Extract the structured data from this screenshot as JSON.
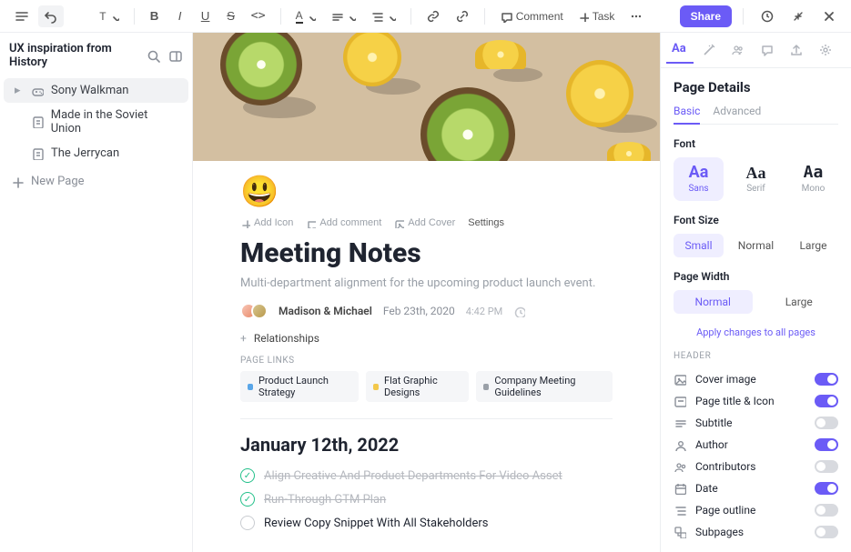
{
  "topbar": {
    "comment": "Comment",
    "task": "Task",
    "share": "Share"
  },
  "sidebar": {
    "title": "UX inspiration from History",
    "items": [
      {
        "label": "Sony Walkman",
        "active": true,
        "icon": "gamepad"
      },
      {
        "label": "Made in the Soviet Union",
        "active": false,
        "icon": "page"
      },
      {
        "label": "The Jerrycan",
        "active": false,
        "icon": "page"
      }
    ],
    "newPage": "New Page"
  },
  "doc": {
    "emoji": "😃",
    "actions": {
      "addIcon": "Add Icon",
      "addComment": "Add comment",
      "addCover": "Add Cover",
      "settings": "Settings"
    },
    "title": "Meeting Notes",
    "subtitle": "Multi-department alignment for the upcoming product launch event.",
    "authors": "Madison & Michael",
    "date": "Feb 23th, 2020",
    "time": "4:42 PM",
    "rel": "Relationships",
    "pageLinksLabel": "PAGE LINKS",
    "links": [
      {
        "label": "Product Launch Strategy",
        "color": "blue"
      },
      {
        "label": "Flat Graphic Designs",
        "color": "yellow"
      },
      {
        "label": "Company Meeting Guidelines",
        "color": "gray"
      }
    ],
    "heading": "January 12th, 2022",
    "todos": [
      {
        "text": "Align Creative And Product Departments For Video Asset",
        "done": true
      },
      {
        "text": "Run-Through GTM Plan",
        "done": true
      },
      {
        "text": "Review Copy Snippet With All Stakeholders",
        "done": false
      }
    ]
  },
  "panel": {
    "title": "Page Details",
    "tabs": {
      "basic": "Basic",
      "advanced": "Advanced"
    },
    "fontLabel": "Font",
    "fonts": [
      {
        "big": "Aa",
        "small": "Sans",
        "cls": "sans",
        "active": true
      },
      {
        "big": "Aa",
        "small": "Serif",
        "cls": "serif",
        "active": false
      },
      {
        "big": "Aa",
        "small": "Mono",
        "cls": "mono",
        "active": false
      }
    ],
    "fontSizeLabel": "Font Size",
    "sizes": [
      {
        "label": "Small",
        "active": true
      },
      {
        "label": "Normal",
        "active": false
      },
      {
        "label": "Large",
        "active": false
      }
    ],
    "pageWidthLabel": "Page Width",
    "widths": [
      {
        "label": "Normal",
        "active": true
      },
      {
        "label": "Large",
        "active": false
      }
    ],
    "apply": "Apply changes to all pages",
    "headerLabel": "HEADER",
    "headerRows": [
      {
        "icon": "image",
        "label": "Cover image",
        "on": true
      },
      {
        "icon": "title",
        "label": "Page title & Icon",
        "on": true
      },
      {
        "icon": "subtitle",
        "label": "Subtitle",
        "on": false
      },
      {
        "icon": "user",
        "label": "Author",
        "on": true
      },
      {
        "icon": "users",
        "label": "Contributors",
        "on": false
      },
      {
        "icon": "calendar",
        "label": "Date",
        "on": true
      },
      {
        "icon": "outline",
        "label": "Page outline",
        "on": false
      },
      {
        "icon": "subpages",
        "label": "Subpages",
        "on": false
      }
    ]
  }
}
